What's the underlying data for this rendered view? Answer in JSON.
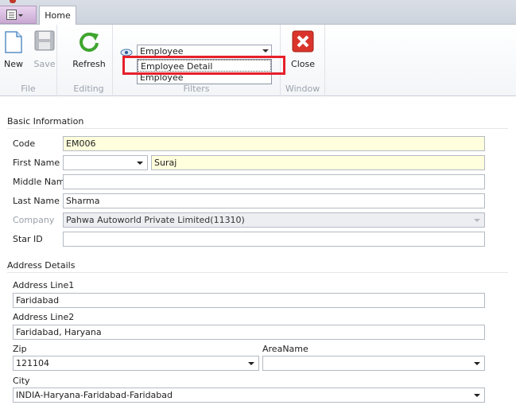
{
  "ribbon": {
    "tab_home": "Home",
    "groups": {
      "file": "File",
      "editing": "Editing",
      "filters": "Filters",
      "window": "Window"
    },
    "buttons": {
      "new": "New",
      "save": "Save",
      "refresh": "Refresh",
      "close": "Close"
    },
    "filter": {
      "selected": "Employee",
      "options": [
        "Employee Detail",
        "Employee"
      ]
    }
  },
  "basic_info": {
    "title": "Basic Information",
    "code_label": "Code",
    "code": "EM006",
    "first_name_label": "First Name",
    "salutation": "",
    "first_name": "Suraj",
    "middle_name_label": "Middle Name",
    "middle_name": "",
    "last_name_label": "Last Name",
    "last_name": "Sharma",
    "company_label": "Company",
    "company": "Pahwa Autoworld Private Limited(11310)",
    "star_id_label": "Star ID",
    "star_id": ""
  },
  "address": {
    "title": "Address Details",
    "line1_label": "Address Line1",
    "line1": "Faridabad",
    "line2_label": "Address Line2",
    "line2": "Faridabad, Haryana",
    "zip_label": "Zip",
    "zip": "121104",
    "area_label": "AreaName",
    "area": "",
    "city_label": "City",
    "city": "INDIA-Haryana-Faridabad-Faridabad"
  },
  "colors": {
    "required_bg": "#ffffdd",
    "highlight": "#e5202a"
  }
}
